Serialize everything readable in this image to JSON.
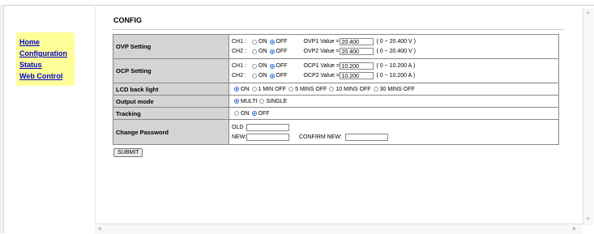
{
  "nav": {
    "items": [
      "Home",
      "Configuration",
      "Status",
      "Web Control"
    ]
  },
  "page": {
    "title": "CONFIG"
  },
  "ovp": {
    "label": "OVP Setting",
    "ch1": {
      "label": "CH1 :",
      "on": "ON",
      "off": "OFF",
      "value_label": "OVP1 Value =",
      "value": "20.400",
      "range": "( 0 ~ 20.400 V )"
    },
    "ch2": {
      "label": "CH2 :",
      "on": "ON",
      "off": "OFF",
      "value_label": "OVP2 Value =",
      "value": "20.400",
      "range": "( 0 ~ 20.400 V )"
    }
  },
  "ocp": {
    "label": "OCP Setting",
    "ch1": {
      "label": "CH1 :",
      "on": "ON",
      "off": "OFF",
      "value_label": "OCP1 Value =",
      "value": "10.200",
      "range": "( 0 ~ 10.200 A )"
    },
    "ch2": {
      "label": "CH2 :",
      "on": "ON",
      "off": "OFF",
      "value_label": "OCP2 Value =",
      "value": "10.200",
      "range": "( 0 ~ 10.200 A )"
    }
  },
  "lcd": {
    "label": "LCD back light",
    "options": [
      "ON",
      "1 MIN OFF",
      "5 MINS OFF",
      "10 MINS OFF",
      "30 MINS OFF"
    ],
    "selected": "ON"
  },
  "output_mode": {
    "label": "Output mode",
    "options": [
      "MULTI",
      "SINGLE"
    ],
    "selected": "MULTI"
  },
  "tracking": {
    "label": "Tracking",
    "options": [
      "ON",
      "OFF"
    ],
    "selected": "OFF"
  },
  "password": {
    "label": "Change Password",
    "old_label": "OLD :",
    "new_label": "NEW:",
    "confirm_label": "CONFIRM NEW:"
  },
  "submit_label": "SUBMIT",
  "colors": {
    "nav_bg": "#ffff99",
    "link": "#0000cc",
    "label_bg": "#d4d4d4",
    "radio_selected": "#2c6bd6"
  }
}
